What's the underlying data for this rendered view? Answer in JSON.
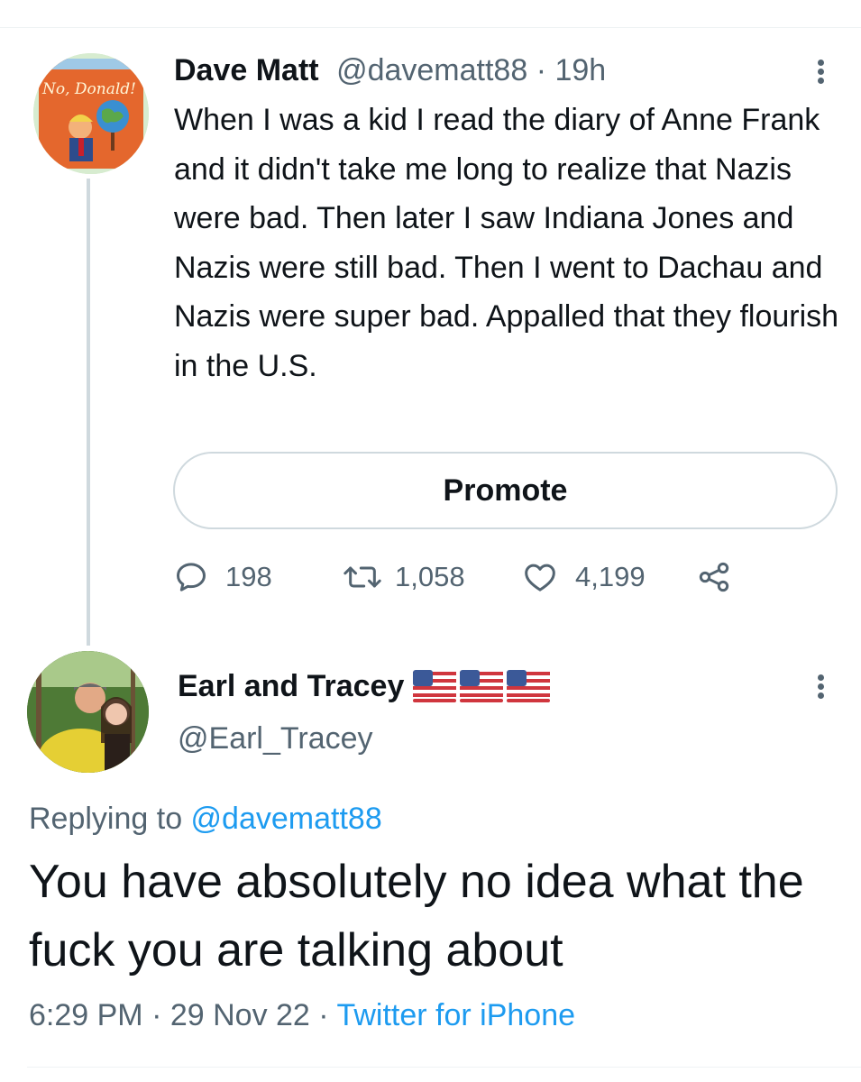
{
  "tweet": {
    "author_name": "Dave Matt",
    "author_handle": "@davematt88",
    "separator": " · ",
    "time_ago": "19h",
    "avatar_text": "No, Donald!",
    "text": "When I was a kid I read the diary of Anne Frank and it didn't take me long to realize that Nazis were bad. Then later I saw Indiana Jones and Nazis were still bad. Then I went to Dachau and Nazis were super bad.   Appalled that they flourish in the U.S.",
    "promote_label": "Promote",
    "replies": "198",
    "retweets": "1,058",
    "likes": "4,199"
  },
  "reply": {
    "author_name": "Earl and Tracey",
    "author_flags": [
      "us-flag",
      "us-flag",
      "us-flag"
    ],
    "author_handle": "@Earl_Tracey",
    "replying_prefix": "Replying to ",
    "replying_to": "@davematt88",
    "text": "You have absolutely no idea what the fuck you are talking about",
    "time": "6:29 PM",
    "date": "29 Nov 22",
    "separator": " · ",
    "client": "Twitter for iPhone"
  },
  "icons": {
    "reply": "comment-bubble-icon",
    "retweet": "retweet-arrows-icon",
    "like": "heart-icon",
    "share": "share-icon",
    "more": "more-vertical-icon"
  },
  "colors": {
    "text": "#0f1419",
    "muted": "#536471",
    "link": "#1d9bf0",
    "border": "#cfd9de"
  }
}
